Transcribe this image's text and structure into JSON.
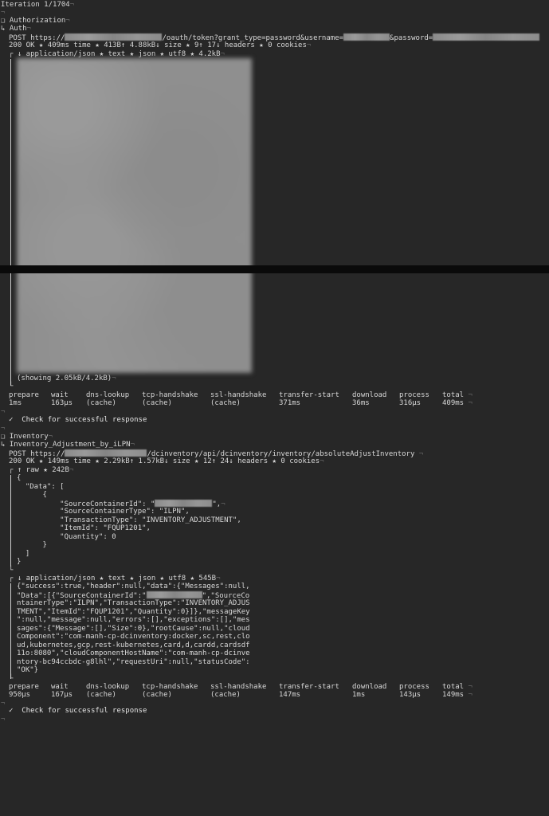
{
  "iteration": "Iteration 1/1704",
  "newline_mark": "¬",
  "req1": {
    "folder": "Authorization",
    "name": "Auth",
    "method_url_prefix": "POST https://",
    "url_path": "/oauth/token?grant_type=password&username=",
    "url_password_param": "&password=",
    "status_line": "200 OK ★ 409ms time ★ 413B↑ 4.88kB↓ size ★ 9↑ 17↓ headers ★ 0 cookies",
    "response_header": "↓ application/json ★ text ★ json ★ utf8 ★ 4.2kB",
    "showing": "(showing 2.05kB/4.2kB)",
    "timing_labels": [
      "prepare",
      "wait",
      "dns-lookup",
      "tcp-handshake",
      "ssl-handshake",
      "transfer-start",
      "download",
      "process",
      "total"
    ],
    "timing_values": [
      "1ms",
      "163µs",
      "(cache)",
      "(cache)",
      "(cache)",
      "371ms",
      "36ms",
      "316µs",
      "409ms"
    ],
    "check": "✓  Check for successful response"
  },
  "req2": {
    "folder": "Inventory",
    "name": "Inventory_Adjustment_by_iLPN",
    "method_url_prefix": "POST https://",
    "url_path": "/dcinventory/api/dcinventory/inventory/absoluteAdjustInventory",
    "status_line": "200 OK ★ 149ms time ★ 2.29kB↑ 1.57kB↓ size ★ 12↑ 24↓ headers ★ 0 cookies",
    "raw_header": "↑ raw ★ 242B",
    "body_lines": [
      "{",
      "  \"Data\": [",
      "      {",
      "          \"SourceContainerId\": \"",
      "          \"SourceContainerType\": \"ILPN\",",
      "          \"TransactionType\": \"INVENTORY_ADJUSTMENT\",",
      "          \"ItemId\": \"FQUP1201\",",
      "          \"Quantity\": 0",
      "      }",
      "  ]",
      "}"
    ],
    "response_header": "↓ application/json ★ text ★ json ★ utf8 ★ 545B",
    "response_lines": [
      "{\"success\":true,\"header\":null,\"data\":{\"Messages\":null,",
      "\"Data\":[{\"SourceContainerId\":\"",
      "ntainerType\":\"ILPN\",\"TransactionType\":\"INVENTORY_ADJUS",
      "TMENT\",\"ItemId\":\"FQUP1201\",\"Quantity\":0}]},\"messageKey",
      "\":null,\"message\":null,\"errors\":[],\"exceptions\":[],\"mes",
      "sages\":{\"Message\":[],\"Size\":0},\"rootCause\":null,\"cloud",
      "Component\":\"com-manh-cp-dcinventory:docker,sc,rest,clo",
      "ud,kubernetes,gcp,rest-kubernetes,card,d,cardd,cardsdf",
      "11o:8080\",\"cloudComponentHostName\":\"com-manh-cp-dcinve",
      "ntory-bc94ccbdc-g8lhl\",\"requestUri\":null,\"statusCode\":",
      "\"OK\"}"
    ],
    "response_line2_suffix": "\",\"SourceCo",
    "timing_labels": [
      "prepare",
      "wait",
      "dns-lookup",
      "tcp-handshake",
      "ssl-handshake",
      "transfer-start",
      "download",
      "process",
      "total"
    ],
    "timing_values": [
      "950µs",
      "167µs",
      "(cache)",
      "(cache)",
      "(cache)",
      "147ms",
      "1ms",
      "143µs",
      "149ms"
    ],
    "check": "✓  Check for successful response"
  },
  "tree": {
    "folder_mark": "❑",
    "item_mark": "↳",
    "open_mark": "┌",
    "line_mark": "│",
    "close_mark": "└"
  }
}
